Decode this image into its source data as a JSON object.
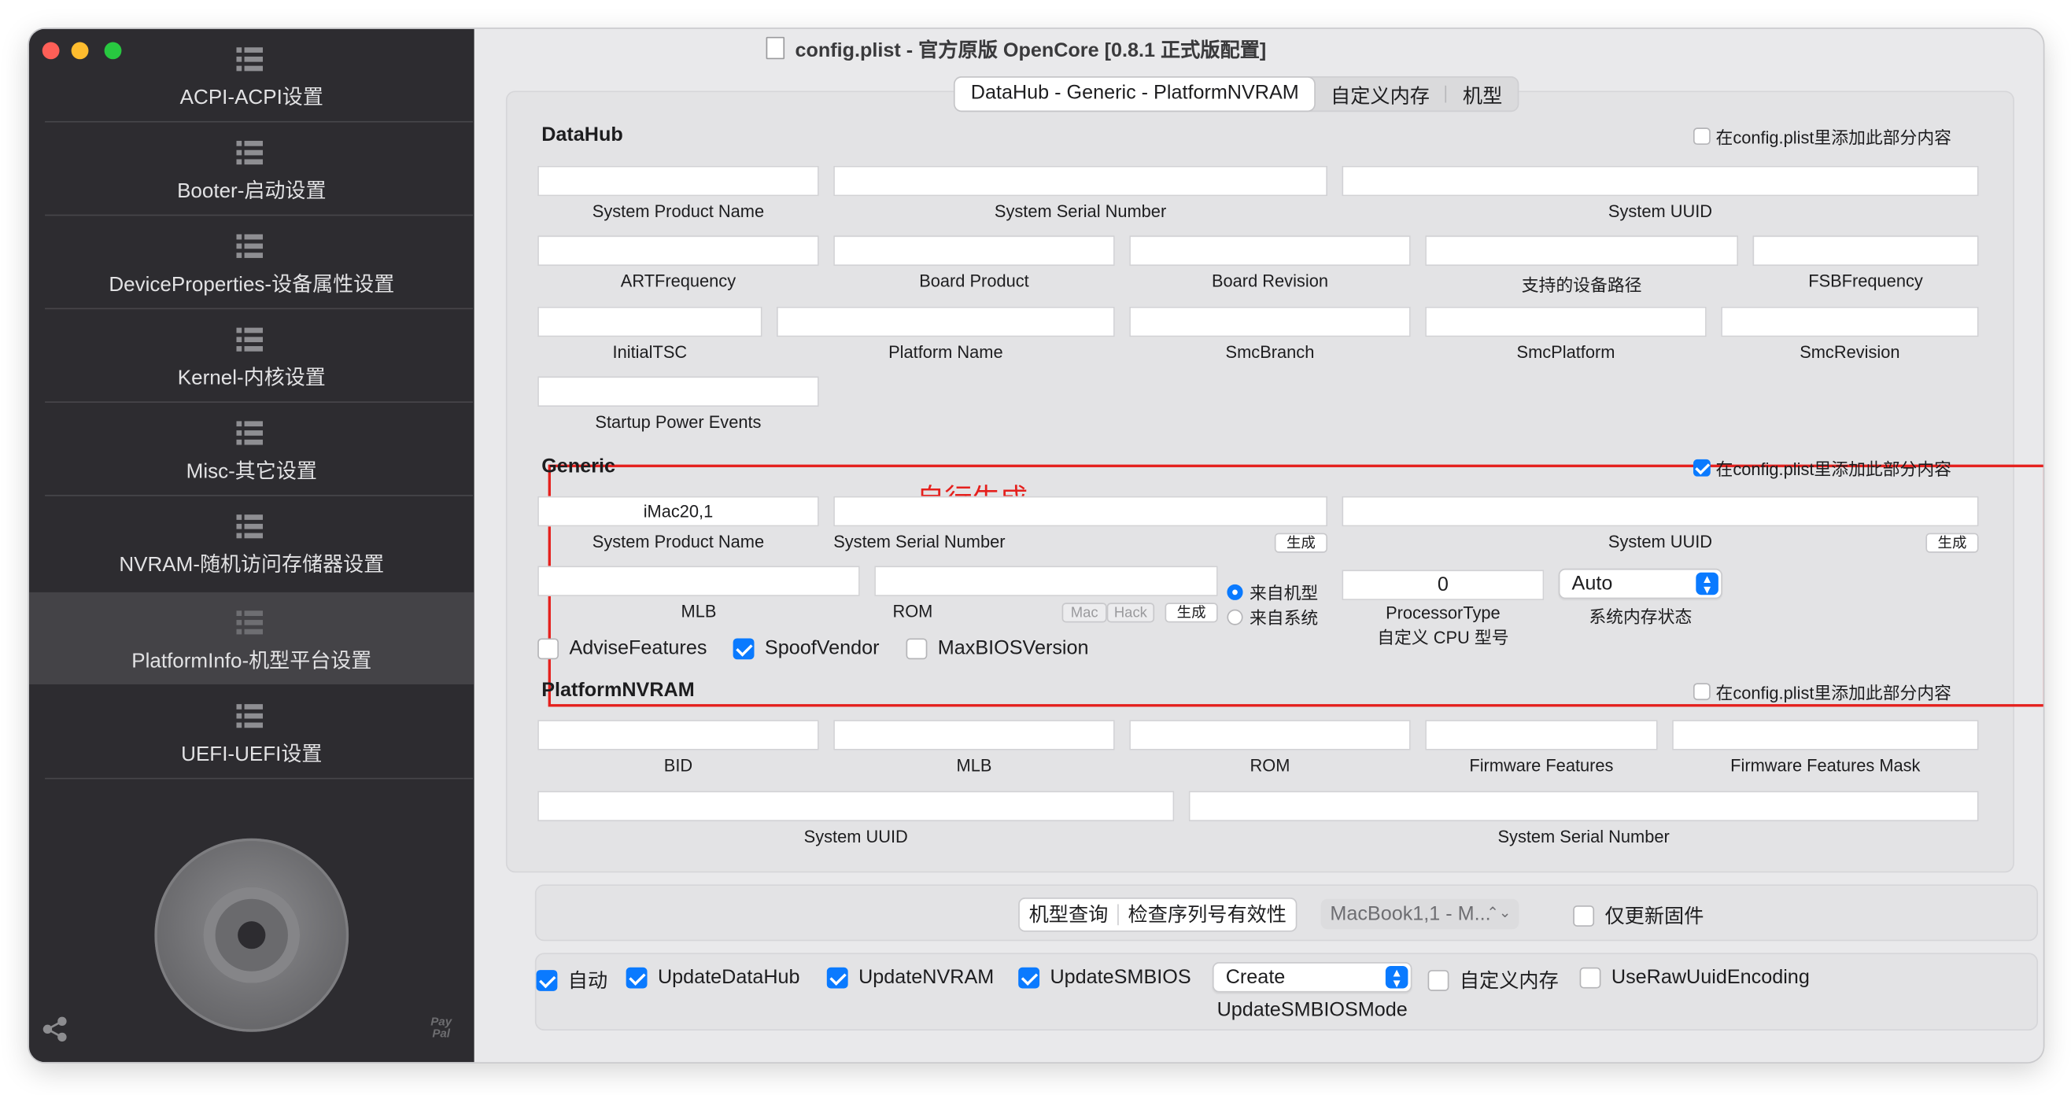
{
  "window": {
    "title": "config.plist - 官方原版 OpenCore [0.8.1 正式版配置]"
  },
  "sidebar": {
    "items": [
      {
        "label": "ACPI-ACPI设置"
      },
      {
        "label": "Booter-启动设置"
      },
      {
        "label": "DeviceProperties-设备属性设置"
      },
      {
        "label": "Kernel-内核设置"
      },
      {
        "label": "Misc-其它设置"
      },
      {
        "label": "NVRAM-随机访问存储器设置"
      },
      {
        "label": "PlatformInfo-机型平台设置",
        "selected": true
      },
      {
        "label": "UEFI-UEFI设置"
      }
    ],
    "footer": {
      "paypal_line1": "Pay",
      "paypal_line2": "Pal"
    }
  },
  "tabs": [
    {
      "label": "DataHub - Generic - PlatformNVRAM",
      "selected": true
    },
    {
      "label": "自定义内存"
    },
    {
      "label": "机型"
    }
  ],
  "datahub": {
    "title": "DataHub",
    "add_label": "在config.plist里添加此部分内容",
    "add_checked": false,
    "fields": {
      "system_product_name": {
        "label": "System Product Name",
        "value": ""
      },
      "system_serial_number": {
        "label": "System Serial Number",
        "value": ""
      },
      "system_uuid": {
        "label": "System UUID",
        "value": ""
      },
      "art_frequency": {
        "label": "ARTFrequency",
        "value": ""
      },
      "board_product": {
        "label": "Board Product",
        "value": ""
      },
      "board_revision": {
        "label": "Board Revision",
        "value": ""
      },
      "device_path": {
        "label": "支持的设备路径",
        "value": ""
      },
      "fsb_frequency": {
        "label": "FSBFrequency",
        "value": ""
      },
      "initial_tsc": {
        "label": "InitialTSC",
        "value": ""
      },
      "platform_name": {
        "label": "Platform Name",
        "value": ""
      },
      "smc_branch": {
        "label": "SmcBranch",
        "value": ""
      },
      "smc_platform": {
        "label": "SmcPlatform",
        "value": ""
      },
      "smc_revision": {
        "label": "SmcRevision",
        "value": ""
      },
      "startup_power_events": {
        "label": "Startup Power Events",
        "value": ""
      }
    }
  },
  "generic": {
    "title": "Generic",
    "annotation": "自行生成",
    "add_label": "在config.plist里添加此部分内容",
    "add_checked": true,
    "system_product_name": {
      "label": "System Product Name",
      "value": "iMac20,1"
    },
    "system_serial_number": {
      "label": "System Serial Number",
      "value": "",
      "generate": "生成"
    },
    "system_uuid": {
      "label": "System UUID",
      "value": "",
      "generate": "生成"
    },
    "mlb": {
      "label": "MLB",
      "value": ""
    },
    "rom": {
      "label": "ROM",
      "value": "",
      "mac": "Mac",
      "hack": "Hack",
      "generate": "生成"
    },
    "rom_source": [
      {
        "label": "来自机型",
        "selected": true
      },
      {
        "label": "来自系统",
        "selected": false
      }
    ],
    "processor_type": {
      "value": "0",
      "label1": "ProcessorType",
      "label2": "自定义 CPU 型号"
    },
    "memory_status": {
      "value": "Auto",
      "label": "系统内存状态"
    },
    "checks": [
      {
        "label": "AdviseFeatures",
        "checked": false
      },
      {
        "label": "SpoofVendor",
        "checked": true
      },
      {
        "label": "MaxBIOSVersion",
        "checked": false
      }
    ]
  },
  "platform_nvram": {
    "title": "PlatformNVRAM",
    "add_label": "在config.plist里添加此部分内容",
    "add_checked": false,
    "fields": {
      "bid": {
        "label": "BID",
        "value": ""
      },
      "mlb": {
        "label": "MLB",
        "value": ""
      },
      "rom": {
        "label": "ROM",
        "value": ""
      },
      "firmware_features": {
        "label": "Firmware Features",
        "value": ""
      },
      "firmware_features_mask": {
        "label": "Firmware Features Mask",
        "value": ""
      },
      "system_uuid": {
        "label": "System UUID",
        "value": ""
      },
      "system_serial_number": {
        "label": "System Serial Number",
        "value": ""
      }
    }
  },
  "toolbar1": {
    "model_query": "机型查询",
    "check_serial": "检查序列号有效性",
    "model_select": "MacBook1,1 - M...",
    "update_firmware_only": "仅更新固件",
    "update_firmware_only_checked": false
  },
  "toolbar2": {
    "checks": [
      {
        "label": "自动",
        "checked": true
      },
      {
        "label": "UpdateDataHub",
        "checked": true
      },
      {
        "label": "UpdateNVRAM",
        "checked": true
      },
      {
        "label": "UpdateSMBIOS",
        "checked": true
      }
    ],
    "smbios_mode": {
      "value": "Create",
      "label": "UpdateSMBIOSMode"
    },
    "custom_memory": {
      "label": "自定义内存",
      "checked": false
    },
    "use_raw_uuid": {
      "label": "UseRawUuidEncoding",
      "checked": false
    }
  },
  "colors": {
    "accent": "#0a7aff",
    "annotation": "#e5201d",
    "sidebar": "#2d2c30"
  }
}
